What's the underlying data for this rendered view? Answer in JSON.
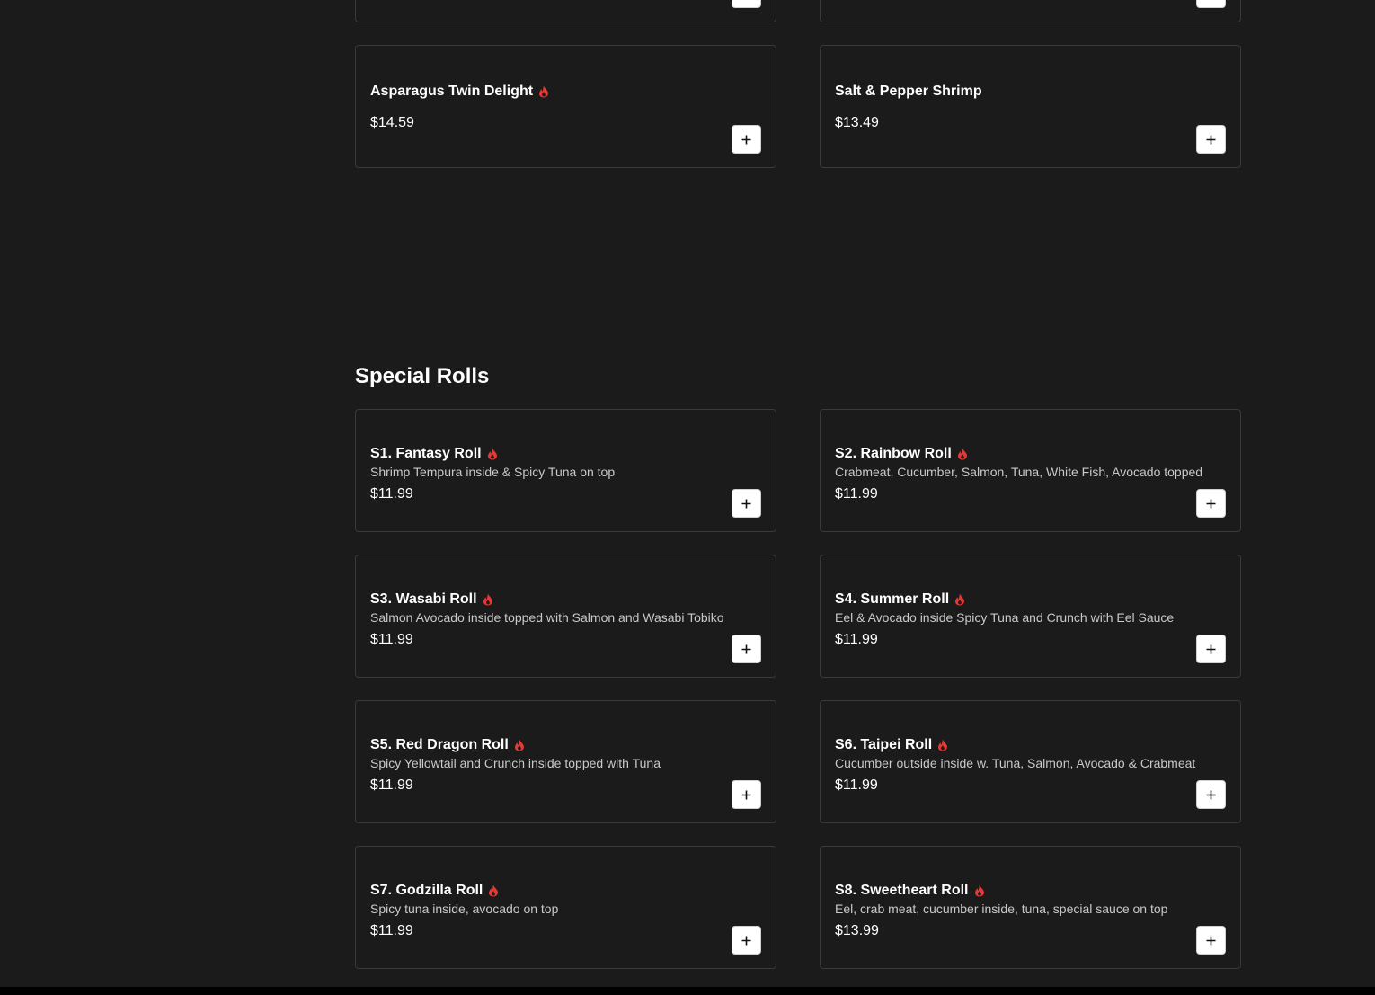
{
  "colors": {
    "background": "#1b1b1b",
    "card_border": "#3a3a3a",
    "spicy_icon": "#e53935",
    "footer": "#000000"
  },
  "icons": {
    "spicy": "flame-icon",
    "add": "plus-icon"
  },
  "previous_section": {
    "items": [
      {
        "name": "",
        "price": "",
        "spicy": false
      },
      {
        "name": "",
        "price": "",
        "spicy": false
      },
      {
        "name": "Asparagus Twin Delight",
        "price": "$14.59",
        "spicy": true
      },
      {
        "name": "Salt & Pepper Shrimp",
        "price": "$13.49",
        "spicy": false
      }
    ]
  },
  "special_rolls": {
    "title": "Special Rolls",
    "items": [
      {
        "name": "S1. Fantasy Roll",
        "description": "Shrimp Tempura inside & Spicy Tuna on top",
        "price": "$11.99",
        "spicy": true
      },
      {
        "name": "S2. Rainbow Roll",
        "description": "Crabmeat, Cucumber, Salmon, Tuna, White Fish, Avocado topped",
        "price": "$11.99",
        "spicy": true
      },
      {
        "name": "S3. Wasabi Roll",
        "description": "Salmon Avocado inside topped with Salmon and Wasabi Tobiko",
        "price": "$11.99",
        "spicy": true
      },
      {
        "name": "S4. Summer Roll",
        "description": "Eel & Avocado inside Spicy Tuna and Crunch with Eel Sauce",
        "price": "$11.99",
        "spicy": true
      },
      {
        "name": "S5. Red Dragon Roll",
        "description": "Spicy Yellowtail and Crunch inside topped with Tuna",
        "price": "$11.99",
        "spicy": true
      },
      {
        "name": "S6. Taipei Roll",
        "description": "Cucumber outside inside w. Tuna, Salmon, Avocado & Crabmeat",
        "price": "$11.99",
        "spicy": true
      },
      {
        "name": "S7. Godzilla Roll",
        "description": "Spicy tuna inside, avocado on top",
        "price": "$11.99",
        "spicy": true
      },
      {
        "name": "S8. Sweetheart Roll",
        "description": "Eel, crab meat, cucumber inside, tuna, special sauce on top",
        "price": "$13.99",
        "spicy": true
      }
    ]
  }
}
